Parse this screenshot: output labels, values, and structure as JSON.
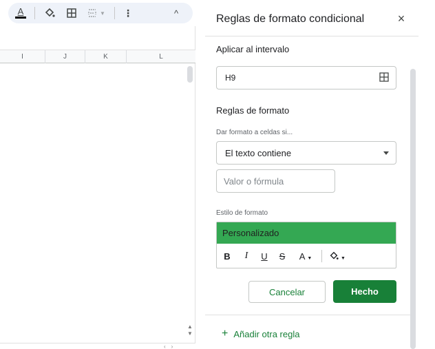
{
  "toolbar": {
    "text_color_icon_label": "A",
    "more_icon": "⋮",
    "collapse_icon": "^"
  },
  "columns": [
    "I",
    "J",
    "K",
    "L"
  ],
  "panel": {
    "title": "Reglas de formato condicional",
    "close_icon": "×",
    "apply_range_label": "Aplicar al intervalo",
    "range_value": "H9",
    "format_rules_label": "Reglas de formato",
    "condition_label": "Dar formato a celdas si...",
    "condition_value": "El texto contiene",
    "value_placeholder": "Valor o fórmula",
    "style_label": "Estilo de formato",
    "style_preview": "Personalizado",
    "style_color": "#34a853",
    "format_buttons": {
      "bold": "B",
      "italic": "I",
      "underline": "U",
      "strikethrough": "S",
      "text_color": "A"
    },
    "cancel_label": "Cancelar",
    "done_label": "Hecho",
    "add_rule_label": "Añadir otra regla",
    "accent_color": "#188038"
  }
}
